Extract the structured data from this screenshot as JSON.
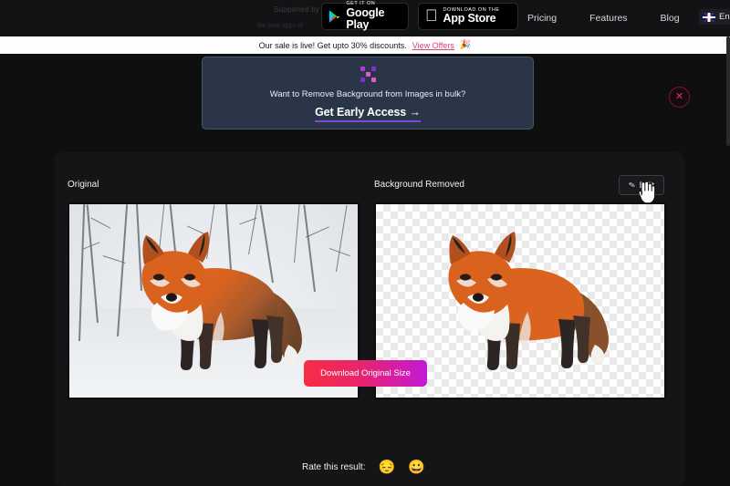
{
  "topnav": {
    "supported_line1": "Supported by",
    "supported_line2": "the best apps of",
    "google_play": {
      "small": "GET IT ON",
      "big": "Google Play",
      "icon": "google-play-icon"
    },
    "app_store": {
      "small": "Download on the",
      "big": "App Store",
      "icon": "apple-icon"
    },
    "links": [
      {
        "label": "Pricing"
      },
      {
        "label": "Features"
      },
      {
        "label": "Blog"
      }
    ],
    "language": {
      "label": "Eng",
      "flag": "uk-flag-icon"
    }
  },
  "promo": {
    "text": "Our sale is live! Get upto 30% discounts.",
    "link": "View Offers",
    "emoji": "🎉"
  },
  "bulk_card": {
    "logo": "removebg-x-logo",
    "question": "Want to Remove Background from Images in bulk?",
    "cta": "Get Early Access  →"
  },
  "result": {
    "close_icon": "✕",
    "original_label": "Original",
    "removed_label": "Background Removed",
    "edit_button": {
      "label": "Edit",
      "icon": "pencil-icon"
    },
    "original_image_alt": "red fox standing in snowy forest",
    "removed_image_alt": "red fox on transparent checkerboard background",
    "download_label": "Download Original Size"
  },
  "rating": {
    "label": "Rate this result:",
    "sad_emoji": "😔",
    "happy_emoji": "😀"
  },
  "colors": {
    "page_bg": "#0f0f10",
    "panel_bg": "#151517",
    "promo_bg": "#fdfdfd",
    "promo_link": "#e0417d",
    "bulk_bg": "#2a3647",
    "bulk_border": "#46566b",
    "cta_underline": "#7d49d8",
    "download_gradient_start": "#f72d44",
    "download_gradient_end": "#c318d6",
    "close_border": "#7d1530"
  }
}
